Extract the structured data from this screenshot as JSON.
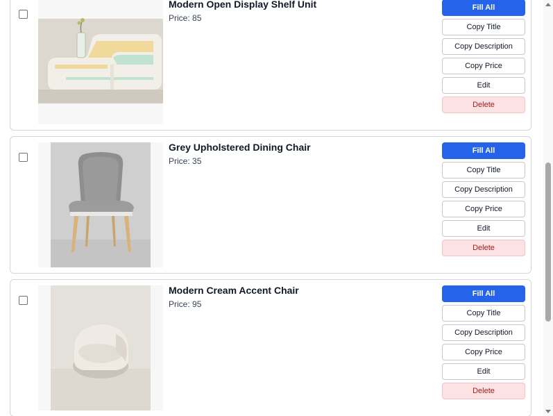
{
  "products": [
    {
      "title": "Modern Open Display Shelf Unit",
      "price_label": "Price:",
      "price": "85",
      "image": "shelf-photo"
    },
    {
      "title": "Grey Upholstered Dining Chair",
      "price_label": "Price:",
      "price": "35",
      "image": "dining-chair-photo"
    },
    {
      "title": "Modern Cream Accent Chair",
      "price_label": "Price:",
      "price": "95",
      "image": "accent-chair-photo"
    }
  ],
  "actions": {
    "fill_all": "Fill All",
    "copy_title": "Copy Title",
    "copy_description": "Copy Description",
    "copy_price": "Copy Price",
    "edit": "Edit",
    "delete": "Delete"
  },
  "colors": {
    "primary": "#2563eb",
    "danger_bg": "#fde2e4",
    "danger_text": "#9b1c1c"
  },
  "scroll_position": 0.48
}
